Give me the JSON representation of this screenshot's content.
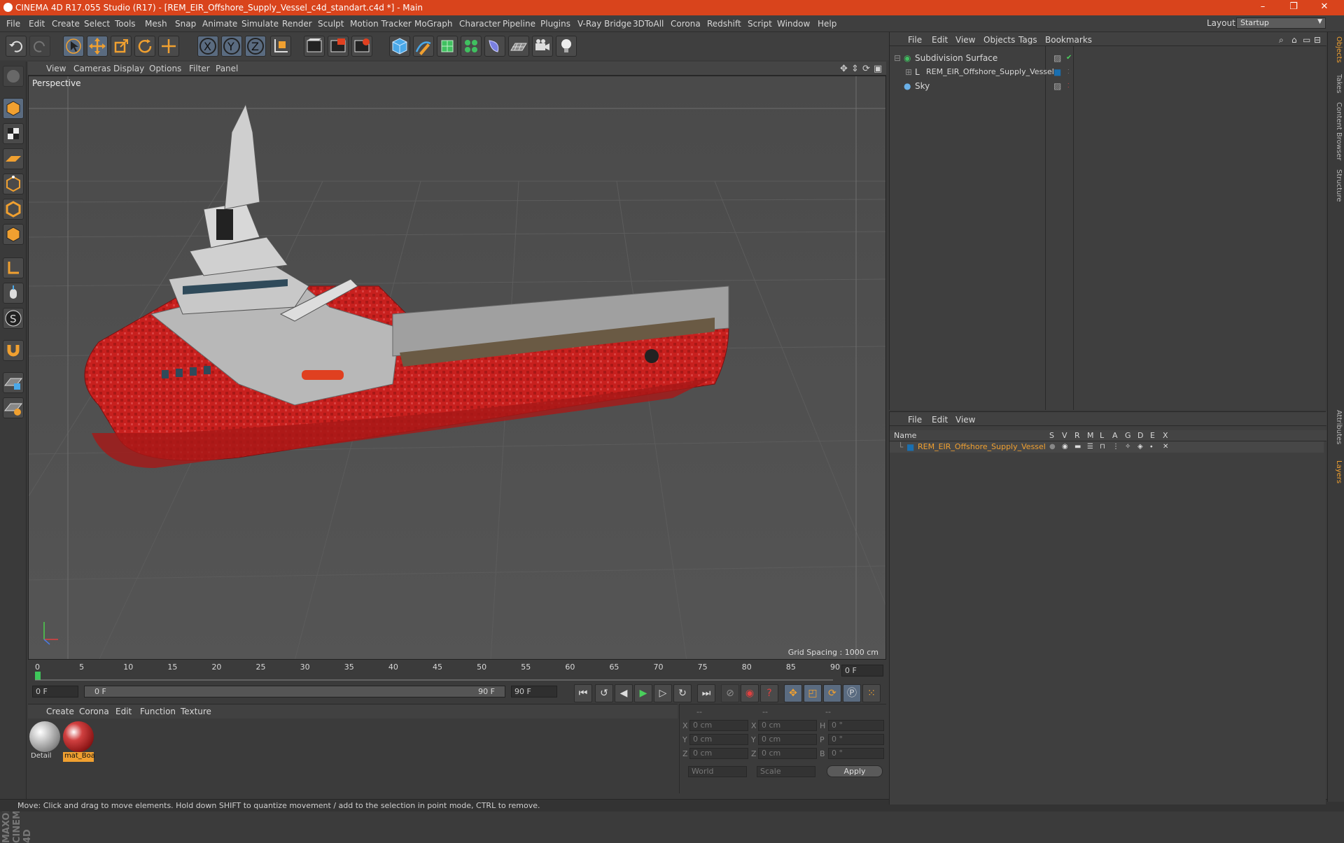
{
  "window": {
    "title": "CINEMA 4D R17.055 Studio (R17) - [REM_EIR_Offshore_Supply_Vessel_c4d_standart.c4d *] - Main",
    "minimize": "–",
    "maximize": "❐",
    "close": "✕"
  },
  "menu": [
    "File",
    "Edit",
    "Create",
    "Select",
    "Tools",
    "Mesh",
    "Snap",
    "Animate",
    "Simulate",
    "Render",
    "Sculpt",
    "Motion Tracker",
    "MoGraph",
    "Character",
    "Pipeline",
    "Plugins",
    "V-Ray Bridge",
    "3DToAll",
    "Corona",
    "Redshift",
    "Script",
    "Window",
    "Help"
  ],
  "layout": {
    "label": "Layout:",
    "value": "Startup"
  },
  "viewport": {
    "menu": [
      "View",
      "Cameras",
      "Display",
      "Options",
      "Filter",
      "Panel"
    ],
    "camera_label": "Perspective",
    "grid_spacing": "Grid Spacing : 1000 cm"
  },
  "timeline": {
    "ticks": [
      "0",
      "5",
      "10",
      "15",
      "20",
      "25",
      "30",
      "35",
      "40",
      "45",
      "50",
      "55",
      "60",
      "65",
      "70",
      "75",
      "80",
      "85",
      "90"
    ],
    "current_frame": "0 F",
    "start": "0 F",
    "range_start": "0 F",
    "range_end": "90 F",
    "end": "90 F"
  },
  "material_manager": {
    "menu": [
      "Create",
      "Corona",
      "Edit",
      "Function",
      "Texture"
    ],
    "materials": [
      {
        "name": "Detail"
      },
      {
        "name": "mat_Boa"
      }
    ]
  },
  "coordinates": {
    "headers": [
      "--",
      "--",
      "--"
    ],
    "rows": [
      {
        "a": "X",
        "a_val": "0 cm",
        "b": "X",
        "b_val": "0 cm",
        "c": "H",
        "c_val": "0 °"
      },
      {
        "a": "Y",
        "a_val": "0 cm",
        "b": "Y",
        "b_val": "0 cm",
        "c": "P",
        "c_val": "0 °"
      },
      {
        "a": "Z",
        "a_val": "0 cm",
        "b": "Z",
        "b_val": "0 cm",
        "c": "B",
        "c_val": "0 °"
      }
    ],
    "mode": "World",
    "transform": "Scale",
    "apply": "Apply"
  },
  "object_manager": {
    "menu": [
      "File",
      "Edit",
      "View",
      "Objects",
      "Tags",
      "Bookmarks"
    ],
    "objects": [
      {
        "name": "Subdivision Surface"
      },
      {
        "name": "REM_EIR_Offshore_Supply_Vessel"
      },
      {
        "name": "Sky"
      }
    ]
  },
  "layer_manager": {
    "menu": [
      "File",
      "Edit",
      "View"
    ],
    "header_name": "Name",
    "header_cols": [
      "S",
      "V",
      "R",
      "M",
      "L",
      "A",
      "G",
      "D",
      "E",
      "X"
    ],
    "layers": [
      {
        "name": "REM_EIR_Offshore_Supply_Vessel"
      }
    ]
  },
  "side_tabs": [
    "Objects",
    "Takes",
    "Content Browser",
    "Structure",
    "Attributes",
    "Layers"
  ],
  "brand": "MAXON CINEMA 4D",
  "status": "Move: Click and drag to move elements. Hold down SHIFT to quantize movement / add to the selection in point mode, CTRL to remove.",
  "colors": {
    "title_bar": "#d9441c",
    "accent": "#f0a030",
    "hull_red": "#c8201e"
  }
}
